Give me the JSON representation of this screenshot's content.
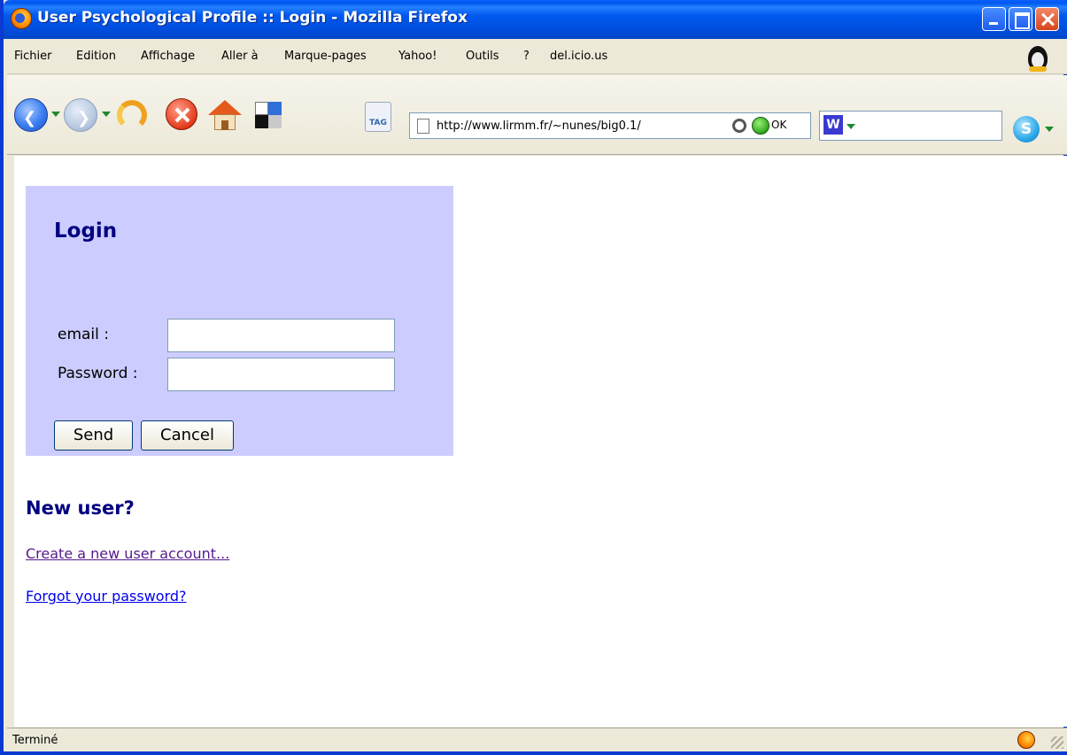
{
  "window": {
    "title": "User Psychological Profile :: Login - Mozilla Firefox"
  },
  "menubar": {
    "items": [
      "Fichier",
      "Edition",
      "Affichage",
      "Aller à",
      "Marque-pages",
      "Yahoo!",
      "Outils",
      "?",
      "del.icio.us"
    ]
  },
  "toolbar": {
    "url": "http://www.lirmm.fr/~nunes/big0.1/",
    "ok_label": "OK",
    "tag_label": "TAG",
    "search_logo": "W",
    "skype_logo": "S"
  },
  "login": {
    "title": "Login",
    "email_label": "email :",
    "email_value": "",
    "password_label": "Password :",
    "password_value": "",
    "send_label": "Send",
    "cancel_label": "Cancel"
  },
  "new_user": {
    "heading": "New user?",
    "create_link": "Create a new user account...",
    "forgot_link": "Forgot your password?"
  },
  "status": {
    "text": "Terminé"
  },
  "colors": {
    "titlebar": "#0058ee",
    "login_box_bg": "#ccccff",
    "heading": "#000080",
    "link": "#0000ee",
    "visited_link": "#551a8b"
  }
}
